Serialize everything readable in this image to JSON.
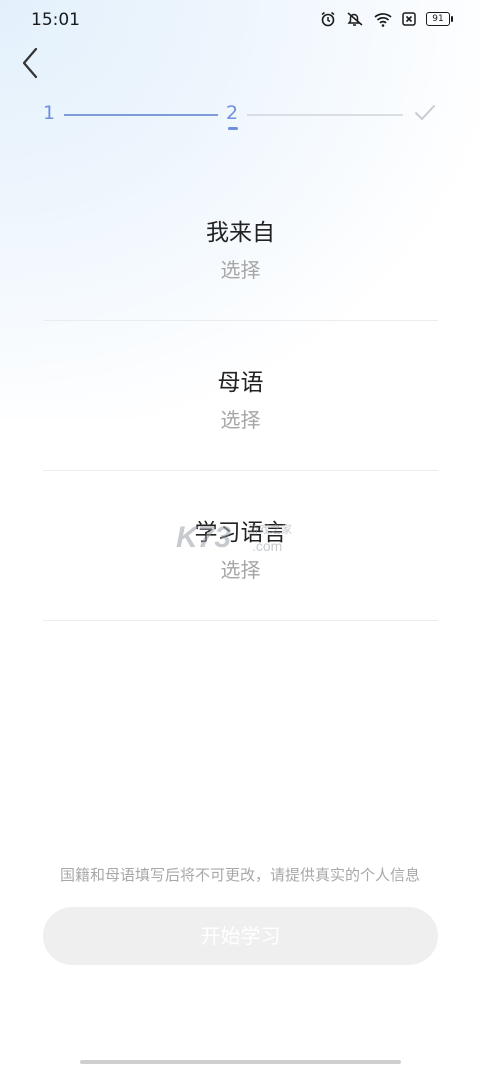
{
  "status_bar": {
    "time": "15:01",
    "battery": "91",
    "icons": [
      "alarm-icon",
      "mute-icon",
      "wifi-icon",
      "no-sim-icon",
      "battery-icon"
    ]
  },
  "stepper": {
    "step1": "1",
    "step2": "2",
    "step3_icon": "check-icon",
    "active_color": "#6f8fe0"
  },
  "fields": [
    {
      "label": "我来自",
      "value": "选择"
    },
    {
      "label": "母语",
      "value": "选择"
    },
    {
      "label": "学习语言",
      "value": "选择"
    }
  ],
  "notice": "国籍和母语填写后将不可更改，请提供真实的个人信息",
  "start_button": "开始学习",
  "watermark": {
    "brand": "K73",
    "site": "游戏之家",
    "domain": ".com"
  }
}
